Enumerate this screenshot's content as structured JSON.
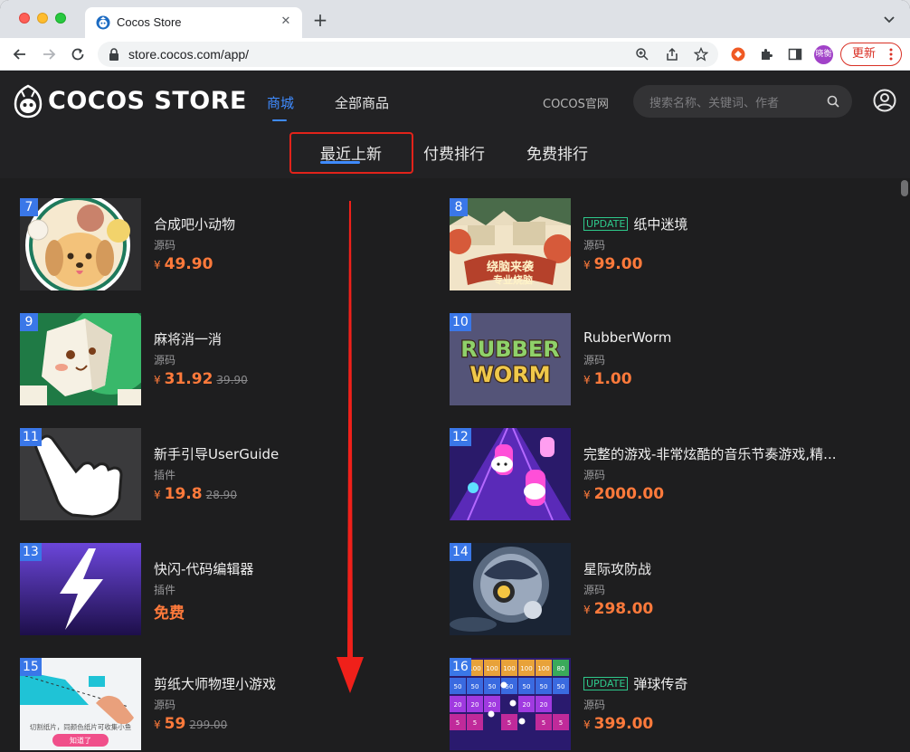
{
  "browser": {
    "tab_title": "Cocos Store",
    "url": "store.cocos.com/app/",
    "profile_label": "晓衡",
    "update_label": "更新"
  },
  "header": {
    "logo_text": "COCOS STORE",
    "nav": [
      "商城",
      "全部商品"
    ],
    "official_link": "COCOS官网",
    "search_placeholder": "搜索名称、关键词、作者",
    "subtabs": [
      "最近上新",
      "付费排行",
      "免费排行"
    ]
  },
  "products": [
    {
      "rank": "7",
      "title": "合成吧小动物",
      "badge": "",
      "category": "源码",
      "price": "49.90",
      "old_price": "",
      "currency": "¥"
    },
    {
      "rank": "8",
      "title": "纸中迷境",
      "badge": "UPDATE",
      "category": "源码",
      "price": "99.00",
      "old_price": "",
      "currency": "¥"
    },
    {
      "rank": "9",
      "title": "麻将消一消",
      "badge": "",
      "category": "源码",
      "price": "31.92",
      "old_price": "39.90",
      "currency": "¥"
    },
    {
      "rank": "10",
      "title": "RubberWorm",
      "badge": "",
      "category": "源码",
      "price": "1.00",
      "old_price": "",
      "currency": "¥"
    },
    {
      "rank": "11",
      "title": "新手引导UserGuide",
      "badge": "",
      "category": "插件",
      "price": "19.8",
      "old_price": "28.90",
      "currency": "¥"
    },
    {
      "rank": "12",
      "title": "完整的游戏-非常炫酷的音乐节奏游戏,精...",
      "badge": "",
      "category": "源码",
      "price": "2000.00",
      "old_price": "",
      "currency": "¥"
    },
    {
      "rank": "13",
      "title": "快闪-代码编辑器",
      "badge": "",
      "category": "插件",
      "price": "免费",
      "old_price": "",
      "currency": ""
    },
    {
      "rank": "14",
      "title": "星际攻防战",
      "badge": "",
      "category": "源码",
      "price": "298.00",
      "old_price": "",
      "currency": "¥"
    },
    {
      "rank": "15",
      "title": "剪纸大师物理小游戏",
      "badge": "",
      "category": "源码",
      "price": "59",
      "old_price": "299.00",
      "currency": "¥"
    },
    {
      "rank": "16",
      "title": "弹球传奇",
      "badge": "UPDATE",
      "category": "源码",
      "price": "399.00",
      "old_price": "",
      "currency": "¥"
    }
  ],
  "thumb_text": {
    "rubber_worm_line1": "RUBBER",
    "rubber_worm_line2": "WORM",
    "papercut_caption": "切割纸片，同颜色纸片可收集小鱼",
    "papercut_button": "知道了",
    "paper_banner_line1": "绕脑来袭",
    "paper_banner_line2": "专业烧脑",
    "brick_numbers": [
      "80",
      "100",
      "100",
      "100",
      "100",
      "100",
      "80",
      "50",
      "50",
      "50",
      "50",
      "50",
      "50",
      "50",
      "20",
      "20",
      "20",
      "20",
      "20",
      "5",
      "5",
      "5",
      "5",
      "5"
    ]
  },
  "colors": {
    "accent_blue": "#3f8bff",
    "price_orange": "#ff7a3b",
    "update_green": "#2ec98b",
    "highlight_red": "#e2231a"
  }
}
